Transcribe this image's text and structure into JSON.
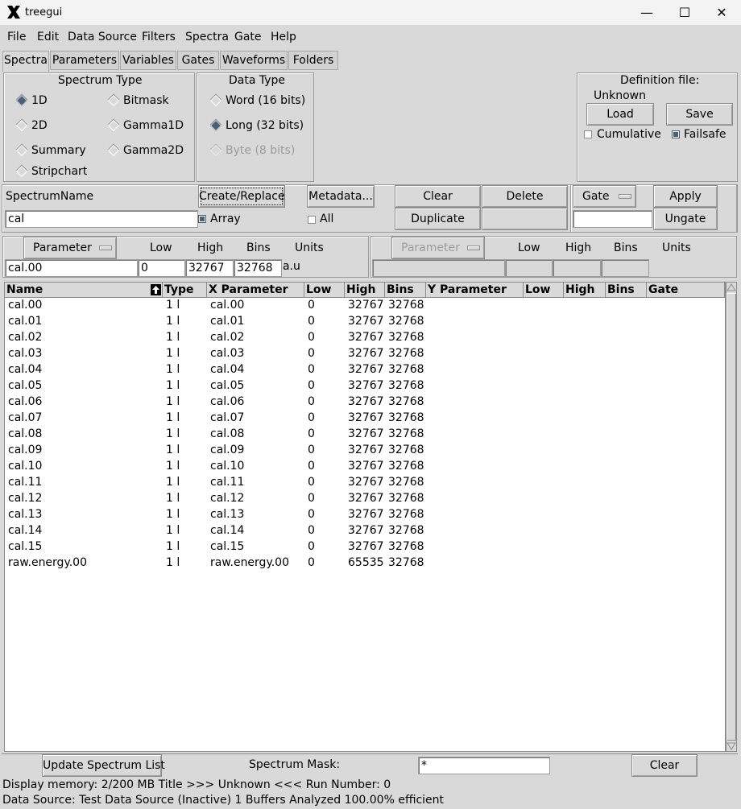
{
  "window": {
    "title": "treegui",
    "minimize": "—",
    "maximize": "☐",
    "close": "✕"
  },
  "menu": [
    "File",
    "Edit",
    "Data Source",
    "Filters",
    "Spectra",
    "Gate",
    "Help"
  ],
  "tabs": [
    "Spectra",
    "Parameters",
    "Variables",
    "Gates",
    "Waveforms",
    "Folders"
  ],
  "spectrum_type": {
    "title": "Spectrum Type",
    "options": [
      "1D",
      "Bitmask",
      "2D",
      "Gamma1D",
      "Summary",
      "Gamma2D",
      "Stripchart"
    ],
    "selected": "1D"
  },
  "data_type": {
    "title": "Data Type",
    "options": [
      "Word (16 bits)",
      "Long (32 bits)",
      "Byte (8 bits)"
    ],
    "selected": "Long (32 bits)"
  },
  "definition_file": {
    "title": "Definition file:",
    "value": "Unknown",
    "load": "Load",
    "save": "Save",
    "cumulative": "Cumulative",
    "failsafe": "Failsafe"
  },
  "spectrum_controls": {
    "name_label": "SpectrumName",
    "name_value": "cal",
    "create_replace": "Create/Replace",
    "array": "Array",
    "metadata": "Metadata...",
    "all": "All",
    "clear": "Clear",
    "delete": "Delete",
    "duplicate": "Duplicate",
    "gate": "Gate",
    "gate_value": "",
    "apply": "Apply",
    "ungate": "Ungate"
  },
  "x_param": {
    "parameter": "Parameter",
    "low": "Low",
    "high": "High",
    "bins": "Bins",
    "units": "Units",
    "param_value": "cal.00",
    "low_value": "0",
    "high_value": "32767",
    "bins_value": "32768",
    "units_value": "a.u"
  },
  "y_param": {
    "parameter": "Parameter",
    "low": "Low",
    "high": "High",
    "bins": "Bins",
    "units": "Units"
  },
  "table": {
    "headers": [
      "Name",
      "Type",
      "X Parameter",
      "Low",
      "High",
      "Bins",
      "Y Parameter",
      "Low",
      "High",
      "Bins",
      "Gate"
    ],
    "rows": [
      [
        "cal.00",
        "1 l",
        "cal.00",
        "0",
        "32767",
        "32768"
      ],
      [
        "cal.01",
        "1 l",
        "cal.01",
        "0",
        "32767",
        "32768"
      ],
      [
        "cal.02",
        "1 l",
        "cal.02",
        "0",
        "32767",
        "32768"
      ],
      [
        "cal.03",
        "1 l",
        "cal.03",
        "0",
        "32767",
        "32768"
      ],
      [
        "cal.04",
        "1 l",
        "cal.04",
        "0",
        "32767",
        "32768"
      ],
      [
        "cal.05",
        "1 l",
        "cal.05",
        "0",
        "32767",
        "32768"
      ],
      [
        "cal.06",
        "1 l",
        "cal.06",
        "0",
        "32767",
        "32768"
      ],
      [
        "cal.07",
        "1 l",
        "cal.07",
        "0",
        "32767",
        "32768"
      ],
      [
        "cal.08",
        "1 l",
        "cal.08",
        "0",
        "32767",
        "32768"
      ],
      [
        "cal.09",
        "1 l",
        "cal.09",
        "0",
        "32767",
        "32768"
      ],
      [
        "cal.10",
        "1 l",
        "cal.10",
        "0",
        "32767",
        "32768"
      ],
      [
        "cal.11",
        "1 l",
        "cal.11",
        "0",
        "32767",
        "32768"
      ],
      [
        "cal.12",
        "1 l",
        "cal.12",
        "0",
        "32767",
        "32768"
      ],
      [
        "cal.13",
        "1 l",
        "cal.13",
        "0",
        "32767",
        "32768"
      ],
      [
        "cal.14",
        "1 l",
        "cal.14",
        "0",
        "32767",
        "32768"
      ],
      [
        "cal.15",
        "1 l",
        "cal.15",
        "0",
        "32767",
        "32768"
      ],
      [
        "raw.energy.00",
        "1 l",
        "raw.energy.00",
        "0",
        "65535",
        "32768"
      ]
    ]
  },
  "bottom": {
    "update": "Update Spectrum List",
    "mask_label": "Spectrum Mask:",
    "mask_value": "*",
    "clear": "Clear"
  },
  "status": {
    "line1": "Display memory: 2/200 MB   Title >>> Unknown <<< Run Number: 0",
    "line2": "Data Source: Test Data Source (Inactive) 1 Buffers Analyzed 100.00% efficient"
  }
}
